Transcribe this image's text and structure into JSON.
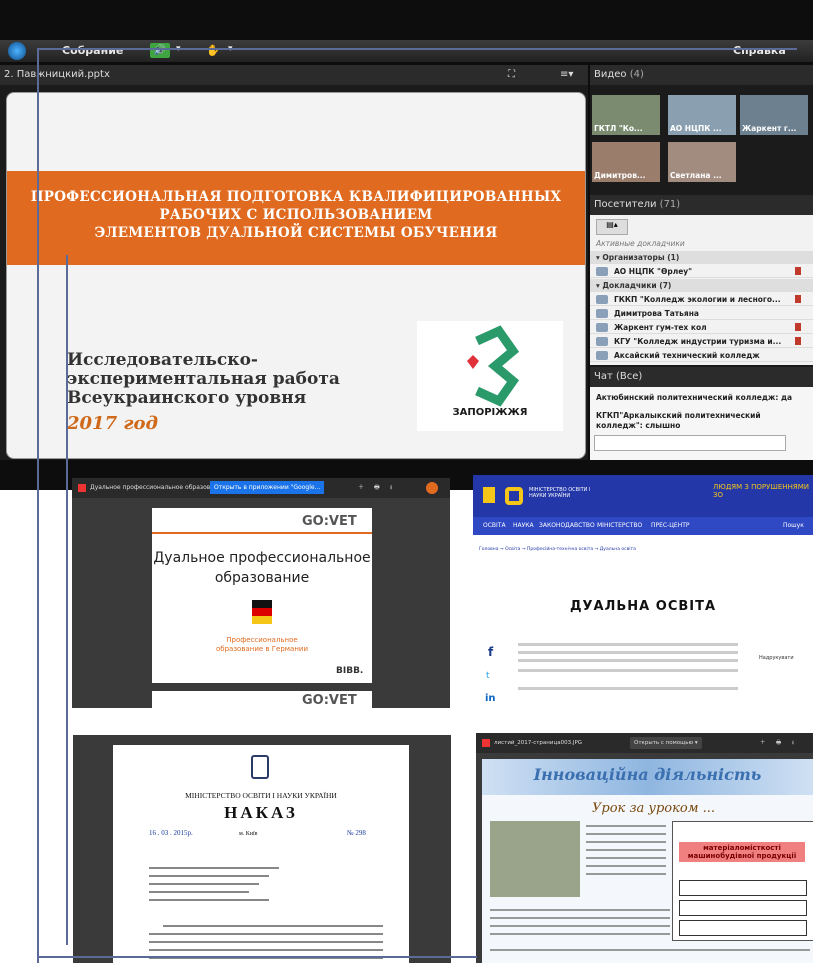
{
  "menubar": {
    "meeting": "Собрание",
    "help": "Справка"
  },
  "slide_pod": {
    "filename": "2. Павжницкий.pptx"
  },
  "slide": {
    "title_lines": [
      "ПРОФЕССИОНАЛЬНАЯ ПОДГОТОВКА КВАЛИФИЦИРОВАННЫХ",
      "РАБОЧИХ С ИСПОЛЬЗОВАНИЕМ",
      "ЭЛЕМЕНТОВ ДУАЛЬНОЙ СИСТЕМЫ ОБУЧЕНИЯ"
    ],
    "research_lines": [
      "Исследовательско-",
      "экспериментальная работа",
      "Всеукраинского уровня"
    ],
    "year": "2017 год",
    "logo_text": "ЗАПОРІЖЖЯ"
  },
  "video_pod": {
    "title": "Видео",
    "count": "(4)",
    "thumbs": [
      "ГКТЛ \"Ко...",
      "АО НЦПК ...",
      "Жаркент г...",
      "Димитров...",
      "Светлана ..."
    ]
  },
  "attendees_pod": {
    "title": "Посетители",
    "count": "(71)",
    "active": "Активные докладчики",
    "items": [
      {
        "group": true,
        "label": "▾ Организаторы (1)"
      },
      {
        "group": false,
        "label": "АО НЦПК \"Өрлеу\"",
        "flag": true
      },
      {
        "group": true,
        "label": "▾ Докладчики (7)"
      },
      {
        "group": false,
        "label": "ГККП \"Колледж экологии и лесного...",
        "flag": true
      },
      {
        "group": false,
        "label": "Димитрова Татьяна",
        "flag": false
      },
      {
        "group": false,
        "label": "Жаркент гум-тех кол",
        "flag": true
      },
      {
        "group": false,
        "label": "КГУ \"Колледж индустрии туризма и...",
        "flag": true
      },
      {
        "group": false,
        "label": "Аксайский технический колледж",
        "flag": false
      }
    ]
  },
  "chat_pod": {
    "title": "Чат",
    "scope": "(Все)",
    "messages": [
      "Актюбинский политехнический колледж: да",
      "КГКП\"Аркалыкский политехнический колледж\": слышно"
    ]
  },
  "shot1": {
    "tab": "Дуальное профессиональное образование в Гер...",
    "open_btn": "Открыть в приложении \"Google...",
    "govet": "GO:VET",
    "title_lines": [
      "Дуальное профессиональное",
      "образование"
    ],
    "sub_lines": [
      "Профессиональное",
      "образование в Германии"
    ],
    "bibb": "BIBB."
  },
  "shot2": {
    "ministry": "МІНІСТЕРСТВО ОСВІТИ І НАУКИ УКРАЇНИ",
    "banner": "ЛЮДЯМ З ПОРУШЕННЯМИ ЗО",
    "nav": [
      "ОСВІТА",
      "НАУКА",
      "ЗАКОНОДАВСТВО",
      "МІНІСТЕРСТВО",
      "ПРЕС-ЦЕНТР",
      "Пошук"
    ],
    "breadcrumb": "Головна → Освіта → Професійна-технічна освіта → Дуальна освіта",
    "heading": "ДУАЛЬНА ОСВІТА",
    "print": "Надрукувати",
    "social": [
      "f",
      "t",
      "in"
    ]
  },
  "shot3": {
    "ministry": "МІНІСТЕРСТВО ОСВІТИ І НАУКИ УКРАЇНИ",
    "title": "НАКАЗ",
    "date": "16 . 03 . 2015р.",
    "city": "м. Київ",
    "number": "№ 298"
  },
  "shot4": {
    "tab": "листий_2017-страница003.JPG",
    "open_btn": "Открыть с помощью ▾",
    "banner": "Інноваційна діяльність",
    "subtitle": "Урок за уроком ...",
    "box_title": "матеріаломісткості машинобудівної продукції"
  },
  "colors": {
    "orange": "#e06b20",
    "frame": "#5a6b99",
    "ministry_blue": "#2337a8",
    "ministry_yellow": "#f5c518"
  }
}
